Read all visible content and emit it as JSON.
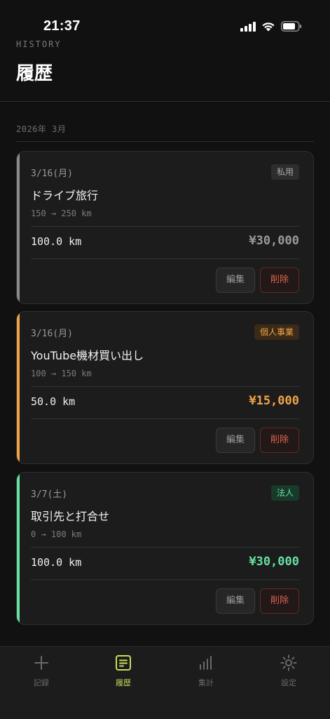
{
  "status_bar": {
    "time": "21:37"
  },
  "header": {
    "subtitle": "HISTORY",
    "title": "履歴"
  },
  "month": {
    "label": "2026年 3月"
  },
  "records": [
    {
      "date": "3/16(月)",
      "badge": "私用",
      "title": "ドライブ旅行",
      "route": "150 → 250 km",
      "distance": "100.0 km",
      "amount": "¥30,000",
      "edit_label": "編集",
      "delete_label": "削除",
      "accent_color": "#8a8a8a",
      "badge_color": "#a8a8a8",
      "badge_bg": "#2d2d2d",
      "amount_color": "#9a9a9a"
    },
    {
      "date": "3/16(月)",
      "badge": "個人事業",
      "title": "YouTube機材買い出し",
      "route": "100 → 150 km",
      "distance": "50.0 km",
      "amount": "¥15,000",
      "edit_label": "編集",
      "delete_label": "削除",
      "accent_color": "#f0a347",
      "badge_color": "#f0a347",
      "badge_bg": "#3a2a17",
      "amount_color": "#f0a347"
    },
    {
      "date": "3/7(土)",
      "badge": "法人",
      "title": "取引先と打合せ",
      "route": "0 → 100 km",
      "distance": "100.0 km",
      "amount": "¥30,000",
      "edit_label": "編集",
      "delete_label": "削除",
      "accent_color": "#67e0a2",
      "badge_color": "#67e0a2",
      "badge_bg": "#183a2a",
      "amount_color": "#67e0a2"
    }
  ],
  "tabs": [
    {
      "label": "記録",
      "icon": "plus-icon",
      "active": false
    },
    {
      "label": "履歴",
      "icon": "history-list-icon",
      "active": true
    },
    {
      "label": "集計",
      "icon": "bar-chart-icon",
      "active": false
    },
    {
      "label": "設定",
      "icon": "gear-icon",
      "active": false
    }
  ],
  "colors": {
    "accent": "#c9de58",
    "background": "#111111",
    "card": "#1c1c1c",
    "delete": "#e0624f"
  }
}
